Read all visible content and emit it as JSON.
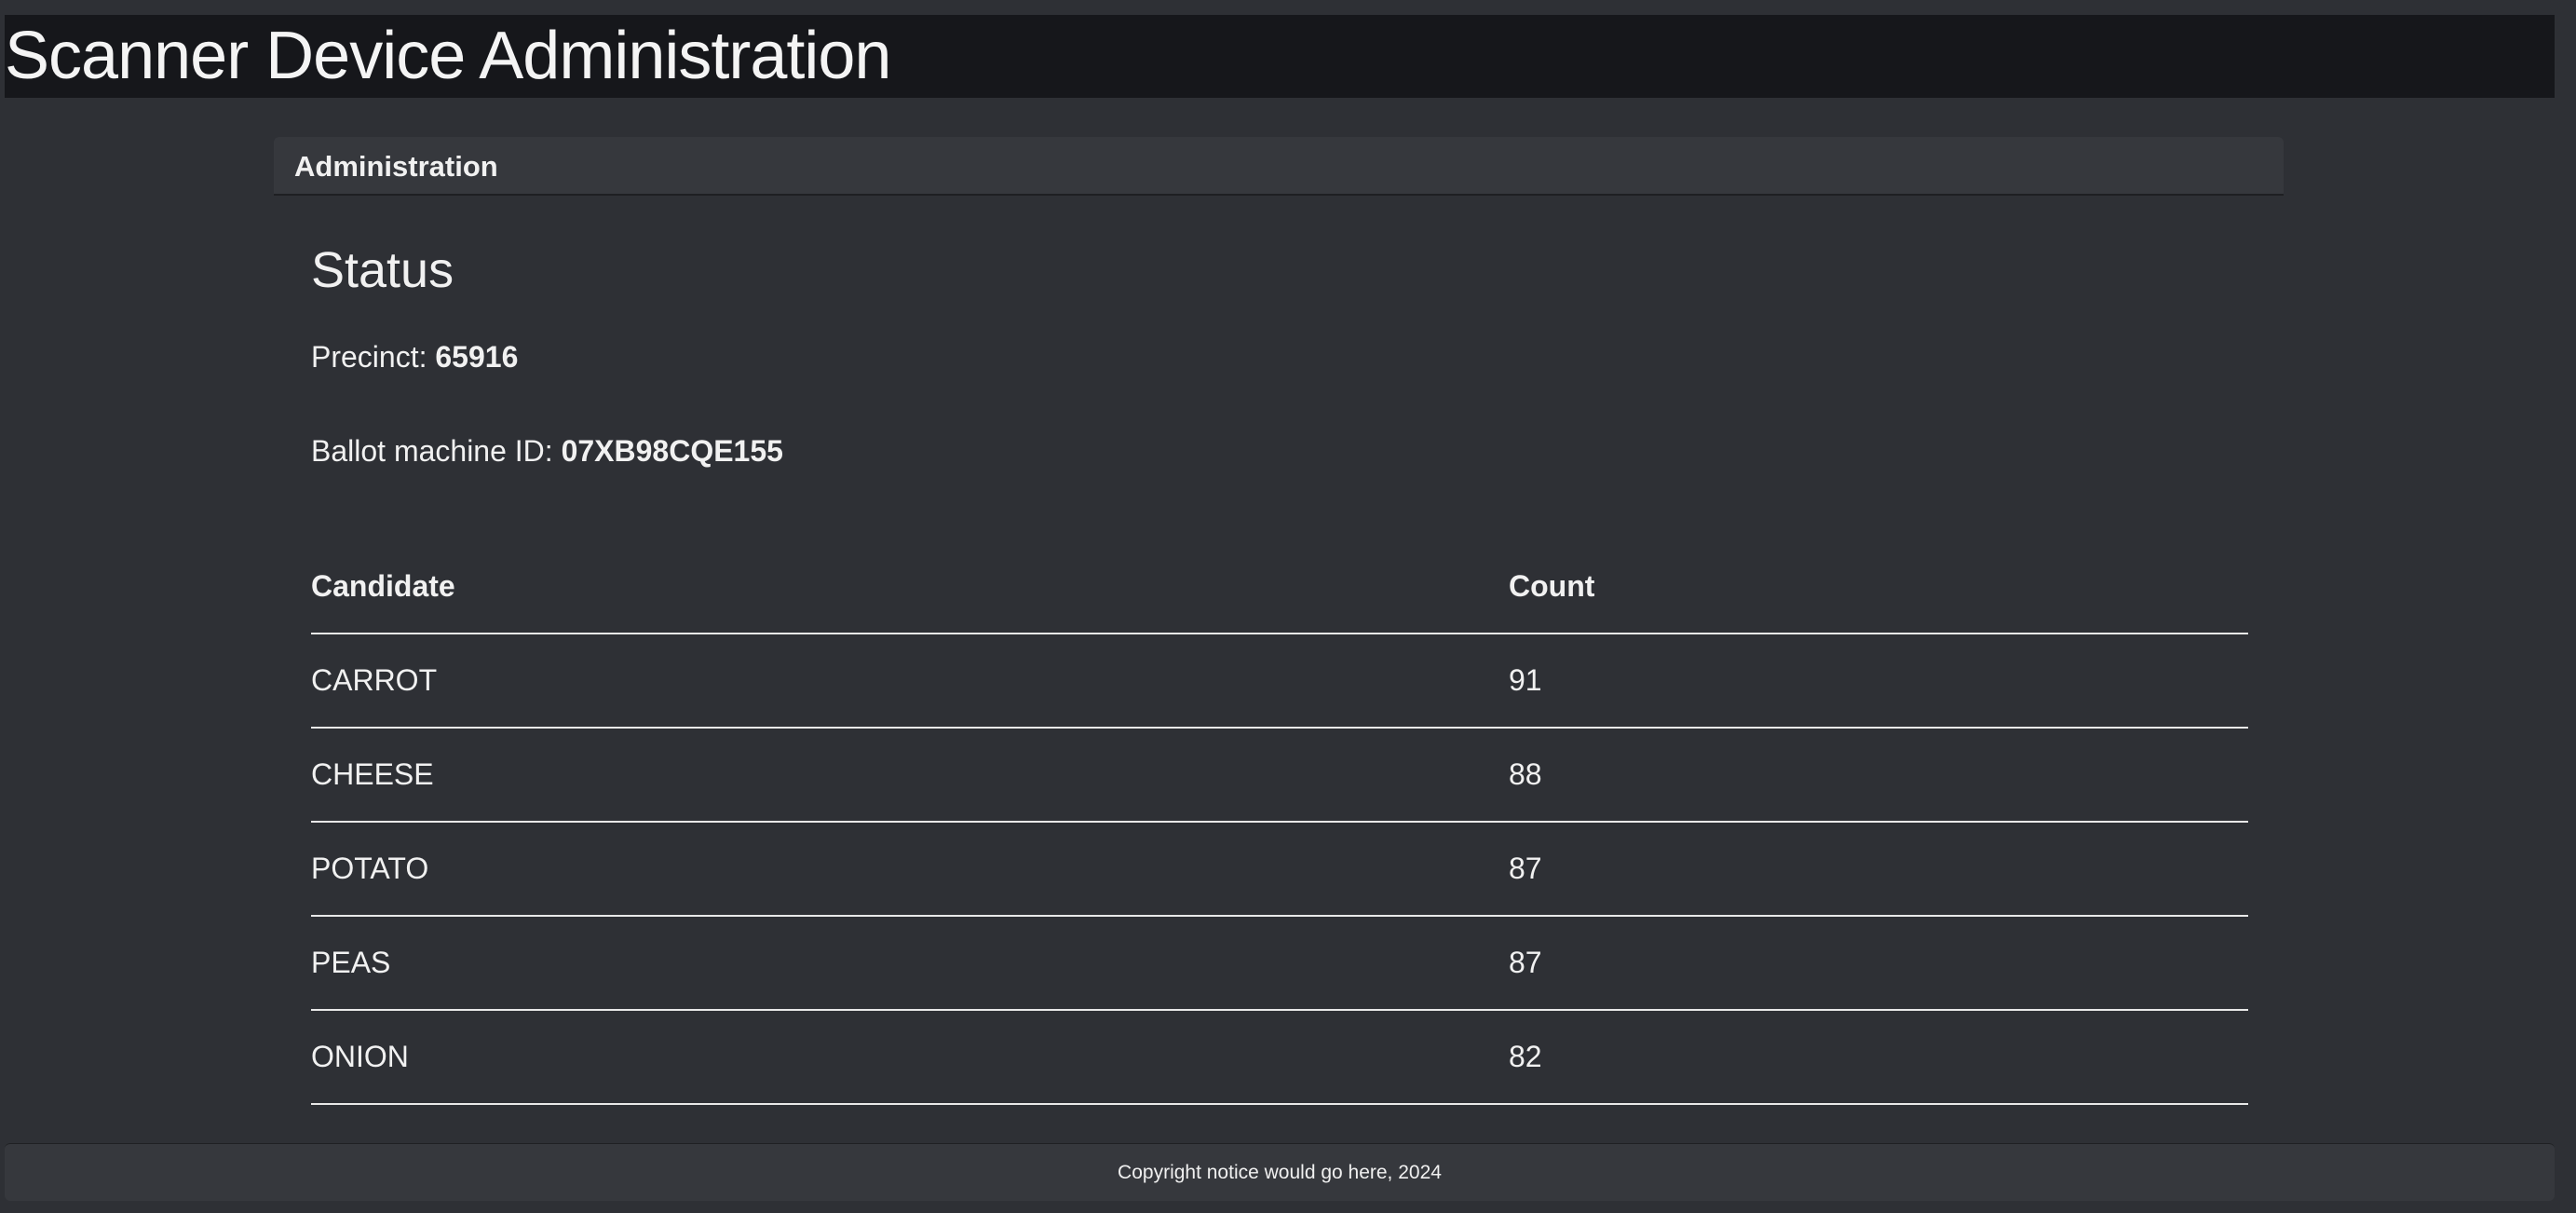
{
  "header": {
    "title": "Scanner Device Administration"
  },
  "card": {
    "title": "Administration"
  },
  "status": {
    "heading": "Status",
    "precinct_label": "Precinct:",
    "precinct_value": "65916",
    "machine_label": "Ballot machine ID:",
    "machine_value": "07XB98CQE155"
  },
  "table": {
    "columns": [
      "Candidate",
      "Count"
    ],
    "rows": [
      {
        "candidate": "CARROT",
        "count": "91"
      },
      {
        "candidate": "CHEESE",
        "count": "88"
      },
      {
        "candidate": "POTATO",
        "count": "87"
      },
      {
        "candidate": "PEAS",
        "count": "87"
      },
      {
        "candidate": "ONION",
        "count": "82"
      }
    ]
  },
  "footer": {
    "text": "Copyright notice would go here, 2024"
  }
}
